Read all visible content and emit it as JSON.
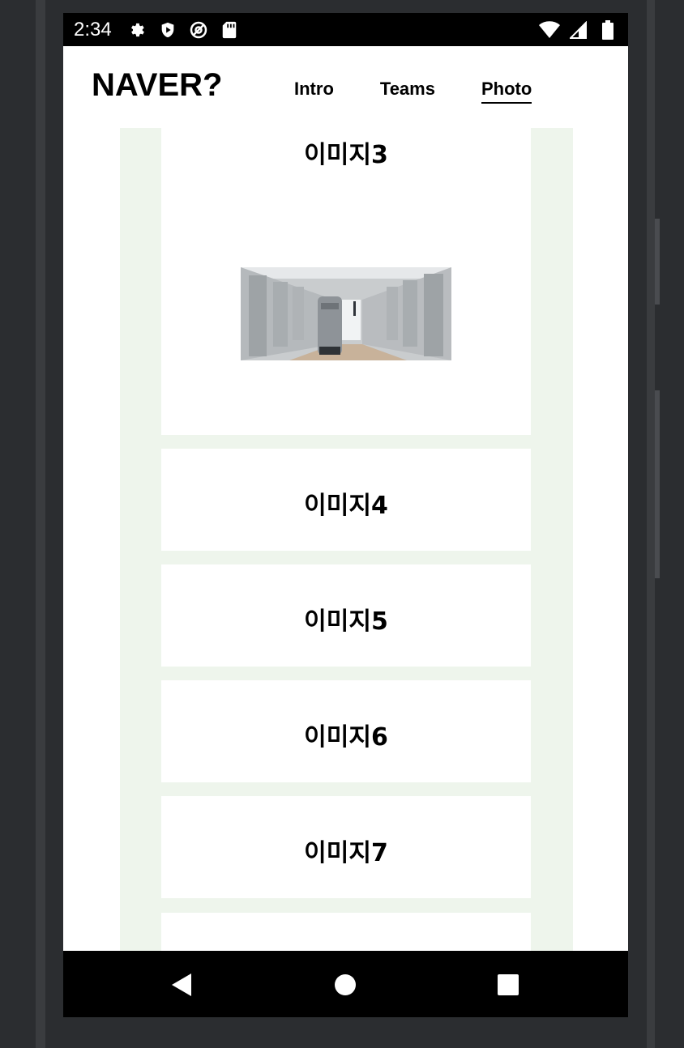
{
  "status_bar": {
    "time": "2:34",
    "left_icons": [
      "gear-icon",
      "shield-play-icon",
      "at-sign-icon",
      "sd-card-icon"
    ],
    "right_icons": [
      "wifi-icon",
      "signal-icon",
      "battery-icon"
    ]
  },
  "header": {
    "logo": "NAVER?",
    "nav": [
      {
        "label": "Intro",
        "active": false
      },
      {
        "label": "Teams",
        "active": false
      },
      {
        "label": "Photo",
        "active": true
      }
    ]
  },
  "gallery": {
    "items": [
      {
        "title": "이미지3",
        "has_photo": true
      },
      {
        "title": "이미지4"
      },
      {
        "title": "이미지5"
      },
      {
        "title": "이미지6"
      },
      {
        "title": "이미지7"
      },
      {
        "title": ""
      }
    ]
  },
  "colors": {
    "column_background": "#eef5ec",
    "card_background": "#ffffff",
    "bars": "#000000"
  },
  "system_nav": {
    "buttons": [
      "back-icon",
      "home-icon",
      "recents-icon"
    ]
  }
}
